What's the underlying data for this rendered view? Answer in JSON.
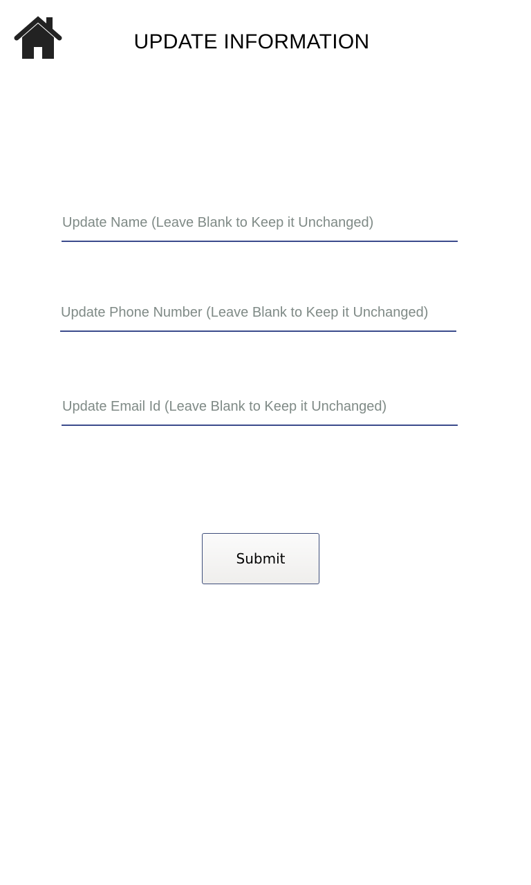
{
  "header": {
    "title": "UPDATE INFORMATION",
    "home_icon": "home-icon"
  },
  "form": {
    "name_field": {
      "value": "",
      "placeholder": "Update Name (Leave Blank to Keep it Unchanged)"
    },
    "phone_field": {
      "value": "",
      "placeholder": "Update Phone Number (Leave Blank to Keep it Unchanged)"
    },
    "email_field": {
      "value": "",
      "placeholder": "Update Email Id (Leave Blank to Keep it Unchanged)"
    },
    "submit_label": "Submit"
  },
  "colors": {
    "underline": "#3a4a8c",
    "placeholder": "#7f8a86",
    "icon": "#222222"
  }
}
